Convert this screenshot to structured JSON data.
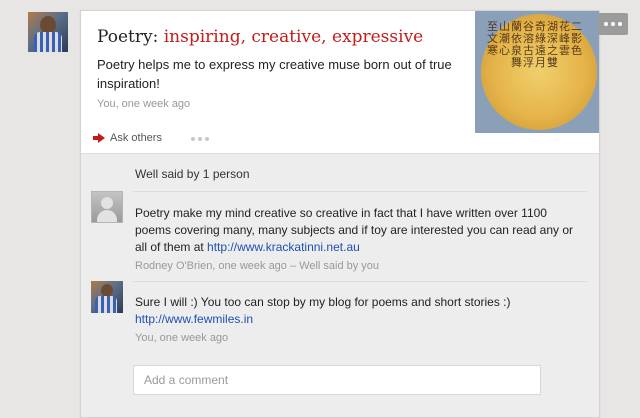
{
  "post": {
    "title_plain": "Poetry:",
    "title_accent": "inspiring, creative, expressive",
    "body": "Poetry helps me to express my creative muse born out of true inspiration!",
    "time": "You, one week ago",
    "ask_label": "Ask others",
    "thumbnail_glyphs": "至山蘭谷奇湖花二文潮依溶綠深峰影寒心泉古遠之雲色舞浮月雙"
  },
  "well_said": "Well said by 1 person",
  "comments": [
    {
      "text": "Poetry make my mind creative so creative in fact that I have written over 1100 poems covering many, many subjects and if toy are interested you can read any or all of them at ",
      "link": "http://www.krackatinni.net.au",
      "meta": "Rodney O'Brien, one week ago – Well said by you"
    },
    {
      "text": "Sure I will :) You too can stop by my blog for poems and short stories :) ",
      "link": "http://www.fewmiles.in",
      "meta": "You, one week ago"
    }
  ],
  "add_comment": {
    "placeholder": "Add a comment"
  },
  "colors": {
    "accent": "#c41a1a",
    "link": "#1e4fb5",
    "meta": "#999999"
  },
  "icons": {
    "ask": "red-arrow-icon",
    "more": "more-dots-icon"
  }
}
